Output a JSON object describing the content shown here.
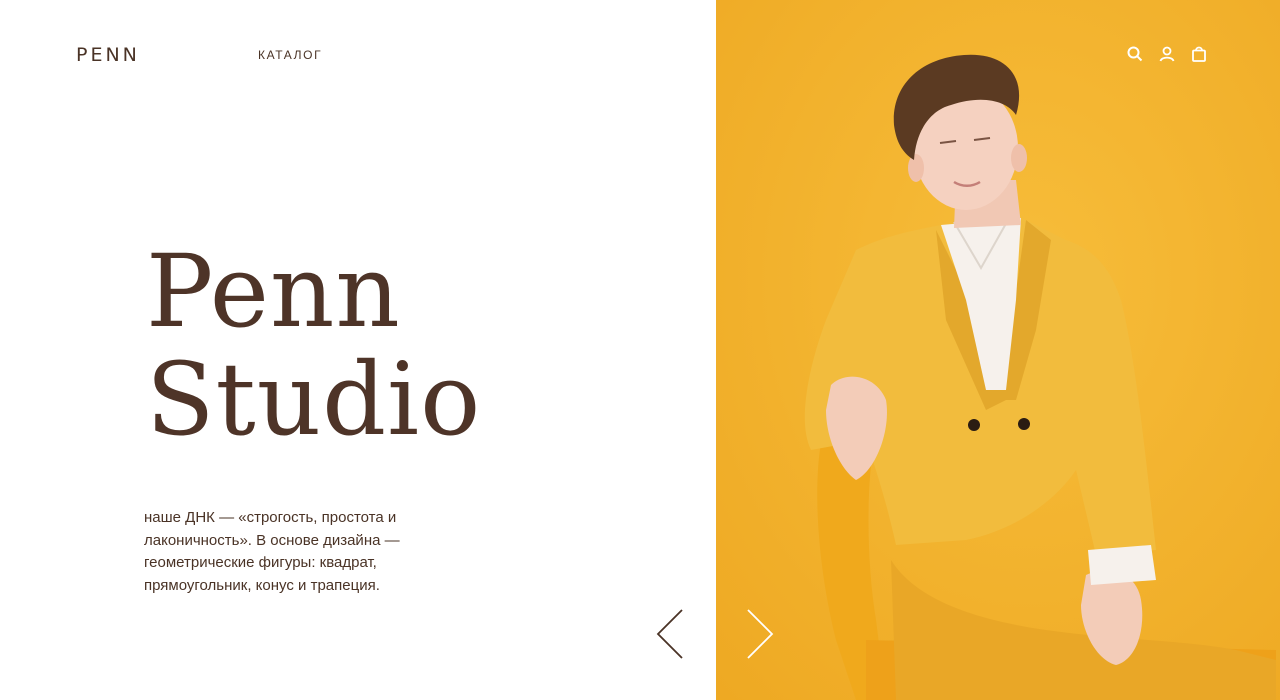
{
  "header": {
    "logo": "PENN",
    "nav": {
      "catalog_label": "КАТАЛОГ"
    },
    "icons": [
      "search-icon",
      "user-icon",
      "bag-icon"
    ]
  },
  "hero": {
    "title_line1": "Penn",
    "title_line2": "Studio",
    "description": "наше ДНК — «строгость, простота и лаконичность». В основе дизайна — геометрические фигуры: квадрат, прямоугольник, конус и трапеция."
  },
  "slider": {
    "prev_icon": "chevron-left-icon",
    "next_icon": "chevron-right-icon"
  },
  "colors": {
    "accent_background": "#f3b12e",
    "text_brown": "#4a3326",
    "page_background": "#ffffff"
  }
}
